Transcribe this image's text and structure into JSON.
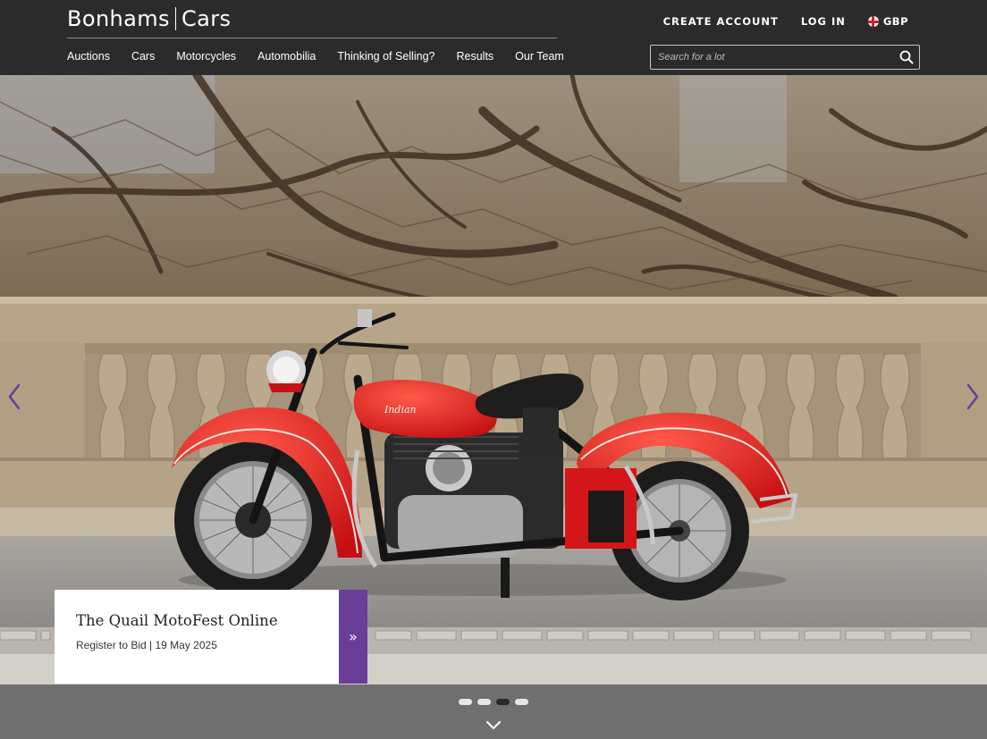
{
  "brand": {
    "logo_primary": "Bonhams",
    "logo_secondary": "Cars"
  },
  "nav": {
    "items": [
      "Auctions",
      "Cars",
      "Motorcycles",
      "Automobilia",
      "Thinking of Selling?",
      "Results",
      "Our Team"
    ]
  },
  "account": {
    "create_account": "CREATE ACCOUNT",
    "log_in": "LOG IN",
    "currency": "GBP",
    "currency_icon": "uk-flag-icon"
  },
  "search": {
    "placeholder": "Search for a lot",
    "icon": "search-icon"
  },
  "hero": {
    "card_title": "The Quail MotoFest Online",
    "card_subtitle": "Register to Bid | 19 May 2025",
    "card_cta_glyph": "»",
    "slides_total": 4,
    "active_slide": 3
  },
  "colors": {
    "header_bg": "#2b2b2b",
    "accent_purple": "#6a3d96",
    "motorcycle_red": "#e01e1e",
    "card_bg": "#ffffff"
  }
}
